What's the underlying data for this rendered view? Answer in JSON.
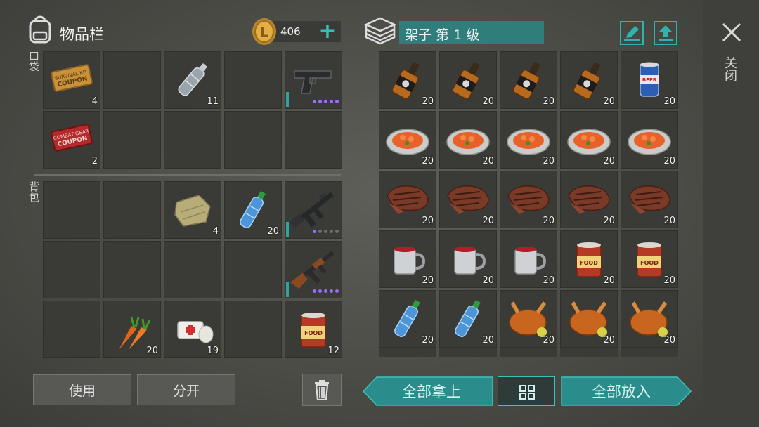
{
  "inventory": {
    "title": "物品栏",
    "coins": "406",
    "pockets_label": "口袋",
    "backpack_label": "背包",
    "pocket_cells": [
      {
        "icon": "survival-coupon-icon",
        "count": "4"
      },
      {
        "icon": "",
        "count": ""
      },
      {
        "icon": "water-bottle-empty-icon",
        "count": "11"
      },
      {
        "icon": "",
        "count": ""
      },
      {
        "icon": "pistol-icon",
        "count": ""
      },
      {
        "icon": "combat-coupon-icon",
        "count": "2"
      },
      {
        "icon": "",
        "count": ""
      },
      {
        "icon": "",
        "count": ""
      },
      {
        "icon": "",
        "count": ""
      },
      {
        "icon": "",
        "count": ""
      }
    ],
    "backpack_cells": [
      {
        "icon": "",
        "count": ""
      },
      {
        "icon": "",
        "count": ""
      },
      {
        "icon": "cloth-icon",
        "count": "4"
      },
      {
        "icon": "water-bottle-icon",
        "count": "20"
      },
      {
        "icon": "assault-rifle-icon",
        "count": ""
      },
      {
        "icon": "",
        "count": ""
      },
      {
        "icon": "",
        "count": ""
      },
      {
        "icon": "",
        "count": ""
      },
      {
        "icon": "",
        "count": ""
      },
      {
        "icon": "ak-rifle-icon",
        "count": ""
      },
      {
        "icon": "",
        "count": ""
      },
      {
        "icon": "carrot-icon",
        "count": "20"
      },
      {
        "icon": "bandage-icon",
        "count": "19"
      },
      {
        "icon": "",
        "count": ""
      },
      {
        "icon": "canned-food-icon",
        "count": "12"
      }
    ],
    "use_label": "使用",
    "split_label": "分开"
  },
  "storage": {
    "title": "架子 第 1 级",
    "close_label": "关闭",
    "take_all_label": "全部拿上",
    "put_all_label": "全部放入",
    "cells": [
      {
        "icon": "whiskey-icon",
        "count": "20"
      },
      {
        "icon": "whiskey-icon",
        "count": "20"
      },
      {
        "icon": "whiskey-icon",
        "count": "20"
      },
      {
        "icon": "whiskey-icon",
        "count": "20"
      },
      {
        "icon": "beer-can-icon",
        "count": "20"
      },
      {
        "icon": "stew-plate-icon",
        "count": "20"
      },
      {
        "icon": "stew-plate-icon",
        "count": "20"
      },
      {
        "icon": "stew-plate-icon",
        "count": "20"
      },
      {
        "icon": "stew-plate-icon",
        "count": "20"
      },
      {
        "icon": "stew-plate-icon",
        "count": "20"
      },
      {
        "icon": "steak-icon",
        "count": "20"
      },
      {
        "icon": "steak-icon",
        "count": "20"
      },
      {
        "icon": "steak-icon",
        "count": "20"
      },
      {
        "icon": "steak-icon",
        "count": "20"
      },
      {
        "icon": "steak-icon",
        "count": "20"
      },
      {
        "icon": "tea-mug-icon",
        "count": "20"
      },
      {
        "icon": "tea-mug-icon",
        "count": "20"
      },
      {
        "icon": "tea-mug-icon",
        "count": "20"
      },
      {
        "icon": "canned-food-icon",
        "count": "20"
      },
      {
        "icon": "canned-food-icon",
        "count": "20"
      },
      {
        "icon": "water-bottle-icon",
        "count": "20"
      },
      {
        "icon": "water-bottle-icon",
        "count": "20"
      },
      {
        "icon": "roast-chicken-icon",
        "count": "20"
      },
      {
        "icon": "roast-chicken-icon",
        "count": "20"
      },
      {
        "icon": "roast-chicken-icon",
        "count": "20"
      }
    ]
  },
  "colors": {
    "accent": "#2fa3a0",
    "cell": "#3a3b37",
    "rarity_purple": "#9b6cff",
    "rarity_grey": "#9a9a9a"
  }
}
